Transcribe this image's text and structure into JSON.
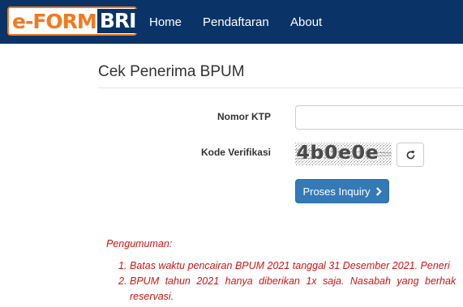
{
  "brand": {
    "e": "e-",
    "form": "FORM",
    "bri": "BRI"
  },
  "nav": {
    "home": "Home",
    "pendaftaran": "Pendaftaran",
    "about": "About"
  },
  "page": {
    "title": "Cek Penerima BPUM"
  },
  "form": {
    "ktp_label": "Nomor KTP",
    "ktp_value": "",
    "kode_label": "Kode Verifikasi",
    "captcha_text": "4b0e0e",
    "submit_label": "Proses Inquiry"
  },
  "announcement": {
    "title": "Pengumuman:",
    "items": [
      {
        "num": "1.",
        "text": "Batas waktu pencairan BPUM 2021 tanggal 31 Desember 2021. Peneri"
      },
      {
        "num": "2.",
        "text": "BPUM tahun 2021 hanya diberikan 1x saja. Nasabah yang berhak",
        "cont": "reservasi."
      }
    ]
  },
  "colors": {
    "navbar": "#0a3467",
    "brand_orange": "#f07a1f",
    "button_primary": "#337ab7",
    "announcement": "#d21414"
  },
  "icons": {
    "refresh": "refresh-icon",
    "chevron": "chevron-right-icon"
  }
}
